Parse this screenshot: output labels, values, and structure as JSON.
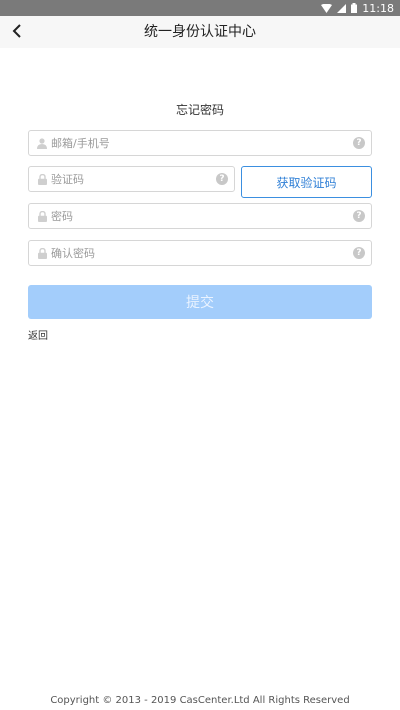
{
  "status_bar": {
    "time": "11:18"
  },
  "app_bar": {
    "title": "统一身份认证中心"
  },
  "form": {
    "title": "忘记密码",
    "account_placeholder": "邮箱/手机号",
    "code_placeholder": "验证码",
    "get_code_label": "获取验证码",
    "password_placeholder": "密码",
    "confirm_placeholder": "确认密码",
    "help_glyph": "?",
    "submit_label": "提交",
    "back_label": "返回"
  },
  "footer": {
    "copyright": "Copyright © 2013 - 2019 CasCenter.Ltd All Rights Reserved"
  },
  "colors": {
    "primary": "#3b8fe0",
    "submit_disabled": "#a3cdfb",
    "status_bar": "#7a7a7a"
  }
}
